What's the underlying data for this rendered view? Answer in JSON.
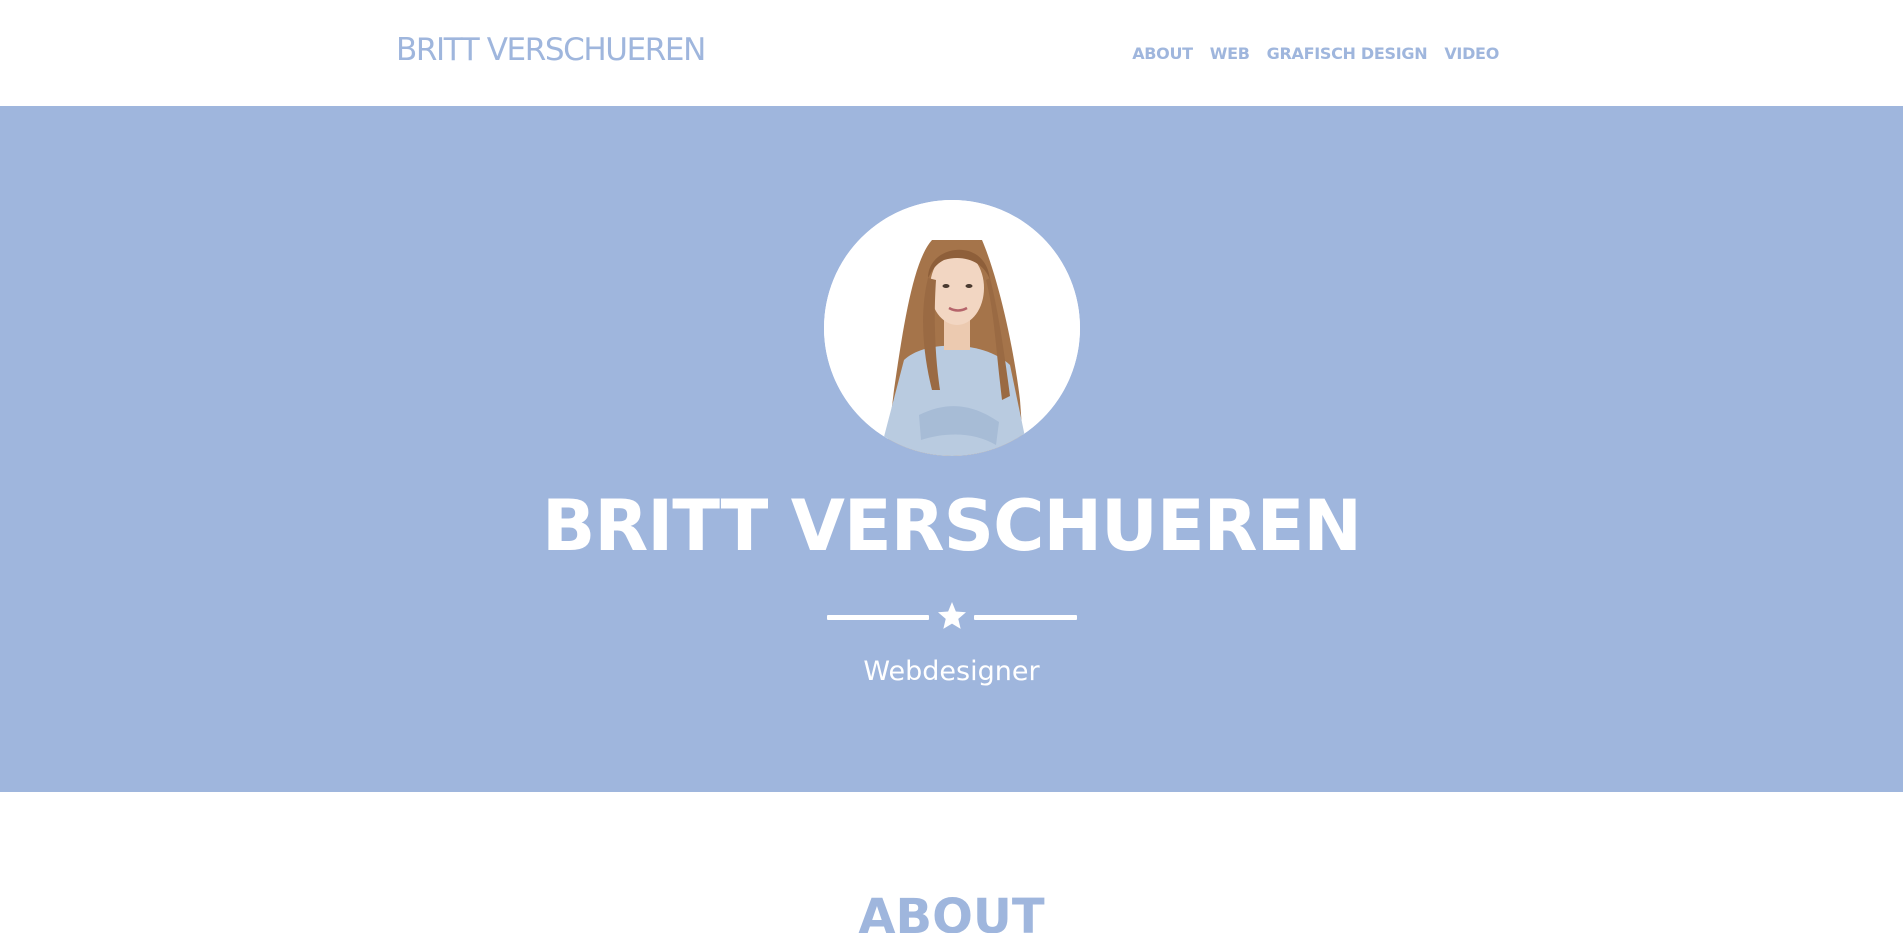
{
  "header": {
    "brand": "BRITT VERSCHUEREN",
    "nav": [
      "ABOUT",
      "WEB",
      "GRAFISCH DESIGN",
      "VIDEO"
    ]
  },
  "hero": {
    "title": "BRITT VERSCHUEREN",
    "subtitle": "Webdesigner",
    "divider_icon": "star-icon"
  },
  "about": {
    "heading": "ABOUT"
  },
  "colors": {
    "accent": "#9fb6dd",
    "background": "#ffffff",
    "hero_text": "#ffffff"
  }
}
